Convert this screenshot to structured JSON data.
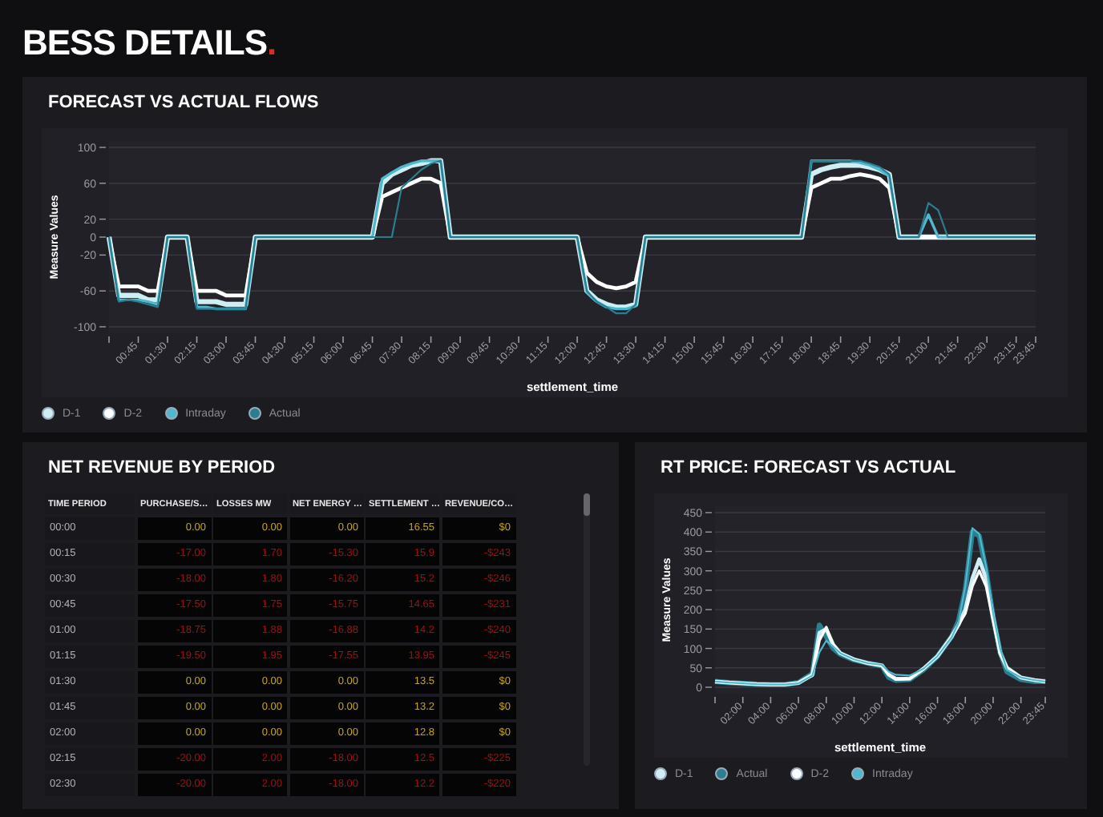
{
  "header": {
    "title": "BESS DETAILS",
    "accent": "."
  },
  "flows": {
    "title": "FORECAST VS ACTUAL FLOWS",
    "chart_data": {
      "type": "line",
      "xlabel": "settlement_time",
      "ylabel": "Measure Values",
      "x": [
        0,
        0.25,
        0.5,
        0.75,
        1,
        1.25,
        1.5,
        1.75,
        2,
        2.25,
        2.5,
        2.75,
        3,
        3.25,
        3.5,
        3.75,
        4,
        4.25,
        4.5,
        4.75,
        5,
        5.25,
        5.5,
        5.75,
        6,
        6.25,
        6.5,
        6.75,
        7,
        7.25,
        7.5,
        7.75,
        8,
        8.25,
        8.5,
        8.75,
        9,
        9.25,
        9.5,
        9.75,
        10,
        10.25,
        10.5,
        10.75,
        11,
        11.25,
        11.5,
        11.75,
        12,
        12.25,
        12.5,
        12.75,
        13,
        13.25,
        13.5,
        13.75,
        14,
        14.25,
        14.5,
        14.75,
        15,
        15.25,
        15.5,
        15.75,
        16,
        16.25,
        16.5,
        16.75,
        17,
        17.25,
        17.5,
        17.75,
        18,
        18.25,
        18.5,
        18.75,
        19,
        19.25,
        19.5,
        19.75,
        20,
        20.25,
        20.5,
        20.75,
        21,
        21.25,
        21.5,
        21.75,
        22,
        22.25,
        22.5,
        22.75,
        23,
        23.25,
        23.5,
        23.75
      ],
      "xlim": [
        0,
        23.75
      ],
      "ylim": [
        -100,
        100
      ],
      "grid": true,
      "yticks": [
        -100,
        -60,
        -20,
        0,
        20,
        60,
        100
      ],
      "xticks": [
        {
          "value": 0.75,
          "label": "00:45"
        },
        {
          "value": 1.5,
          "label": "01:30"
        },
        {
          "value": 2.25,
          "label": "02:15"
        },
        {
          "value": 3,
          "label": "03:00"
        },
        {
          "value": 3.75,
          "label": "03:45"
        },
        {
          "value": 4.5,
          "label": "04:30"
        },
        {
          "value": 5.25,
          "label": "05:15"
        },
        {
          "value": 6,
          "label": "06:00"
        },
        {
          "value": 6.75,
          "label": "06:45"
        },
        {
          "value": 7.5,
          "label": "07:30"
        },
        {
          "value": 8.25,
          "label": "08:15"
        },
        {
          "value": 9,
          "label": "09:00"
        },
        {
          "value": 9.75,
          "label": "09:45"
        },
        {
          "value": 10.5,
          "label": "10:30"
        },
        {
          "value": 11.25,
          "label": "11:15"
        },
        {
          "value": 12,
          "label": "12:00"
        },
        {
          "value": 12.75,
          "label": "12:45"
        },
        {
          "value": 13.5,
          "label": "13:30"
        },
        {
          "value": 14.25,
          "label": "14:15"
        },
        {
          "value": 15,
          "label": "15:00"
        },
        {
          "value": 15.75,
          "label": "15:45"
        },
        {
          "value": 16.5,
          "label": "16:30"
        },
        {
          "value": 17.25,
          "label": "17:15"
        },
        {
          "value": 18,
          "label": "18:00"
        },
        {
          "value": 18.75,
          "label": "18:45"
        },
        {
          "value": 19.5,
          "label": "19:30"
        },
        {
          "value": 20.25,
          "label": "20:15"
        },
        {
          "value": 21,
          "label": "21:00"
        },
        {
          "value": 21.75,
          "label": "21:45"
        },
        {
          "value": 22.5,
          "label": "22:30"
        },
        {
          "value": 23.25,
          "label": "23:15"
        },
        {
          "value": 23.75,
          "label": "23:45"
        }
      ],
      "series": [
        {
          "name": "D-1",
          "color": "#cfeef4",
          "values": [
            0,
            -65,
            -65,
            -65,
            -70,
            -70,
            0,
            0,
            0,
            -72,
            -72,
            -72,
            -75,
            -75,
            -75,
            0,
            0,
            0,
            0,
            0,
            0,
            0,
            0,
            0,
            0,
            0,
            0,
            0,
            60,
            70,
            75,
            80,
            82,
            85,
            85,
            0,
            0,
            0,
            0,
            0,
            0,
            0,
            0,
            0,
            0,
            0,
            0,
            0,
            0,
            -60,
            -70,
            -75,
            -78,
            -78,
            -75,
            0,
            0,
            0,
            0,
            0,
            0,
            0,
            0,
            0,
            0,
            0,
            0,
            0,
            0,
            0,
            0,
            0,
            70,
            75,
            78,
            80,
            80,
            80,
            78,
            75,
            70,
            0,
            0,
            0,
            0,
            0,
            0,
            0,
            0,
            0,
            0,
            0,
            0,
            0,
            0,
            0
          ]
        },
        {
          "name": "D-2",
          "color": "#ffffff",
          "values": [
            0,
            -55,
            -55,
            -55,
            -60,
            -60,
            0,
            0,
            0,
            -60,
            -60,
            -60,
            -65,
            -65,
            -65,
            0,
            0,
            0,
            0,
            0,
            0,
            0,
            0,
            0,
            0,
            0,
            0,
            0,
            45,
            50,
            55,
            60,
            65,
            65,
            60,
            0,
            0,
            0,
            0,
            0,
            0,
            0,
            0,
            0,
            0,
            0,
            0,
            0,
            0,
            -40,
            -50,
            -55,
            -57,
            -55,
            -50,
            0,
            0,
            0,
            0,
            0,
            0,
            0,
            0,
            0,
            0,
            0,
            0,
            0,
            0,
            0,
            0,
            0,
            55,
            60,
            65,
            65,
            68,
            70,
            68,
            65,
            55,
            0,
            0,
            0,
            0,
            0,
            0,
            0,
            0,
            0,
            0,
            0,
            0,
            0,
            0,
            0
          ]
        },
        {
          "name": "Intraday",
          "color": "#4fb8cc",
          "values": [
            0,
            -70,
            -70,
            -70,
            -72,
            -75,
            0,
            0,
            0,
            -78,
            -78,
            -80,
            -80,
            -80,
            -80,
            0,
            0,
            0,
            0,
            0,
            0,
            0,
            0,
            0,
            0,
            0,
            0,
            0,
            65,
            72,
            78,
            82,
            85,
            85,
            85,
            0,
            0,
            0,
            0,
            0,
            0,
            0,
            0,
            0,
            0,
            0,
            0,
            0,
            0,
            -62,
            -72,
            -78,
            -80,
            -80,
            -77,
            0,
            0,
            0,
            0,
            0,
            0,
            0,
            0,
            0,
            0,
            0,
            0,
            0,
            0,
            0,
            0,
            0,
            85,
            85,
            85,
            85,
            85,
            83,
            80,
            75,
            68,
            0,
            0,
            0,
            25,
            0,
            0,
            0,
            0,
            0,
            0,
            0,
            0,
            0,
            0,
            0
          ]
        },
        {
          "name": "Actual",
          "color": "#2b7d8f",
          "values": [
            0,
            -72,
            -70,
            -72,
            -75,
            -78,
            0,
            0,
            0,
            -80,
            -80,
            -80,
            -80,
            -80,
            -80,
            0,
            0,
            0,
            0,
            0,
            0,
            0,
            0,
            0,
            0,
            0,
            0,
            0,
            0,
            0,
            55,
            65,
            75,
            82,
            85,
            0,
            0,
            0,
            0,
            0,
            0,
            0,
            0,
            0,
            0,
            0,
            0,
            0,
            0,
            -60,
            -72,
            -78,
            -85,
            -85,
            -75,
            0,
            0,
            0,
            0,
            0,
            0,
            0,
            0,
            0,
            0,
            0,
            0,
            0,
            0,
            0,
            0,
            0,
            85,
            85,
            85,
            85,
            85,
            85,
            82,
            78,
            70,
            0,
            0,
            0,
            38,
            30,
            0,
            0,
            0,
            0,
            0,
            0,
            0,
            0,
            0,
            0
          ]
        }
      ]
    }
  },
  "revenue": {
    "title": "NET REVENUE BY PERIOD",
    "columns": [
      "TIME PERIOD",
      "PURCHASE/S…",
      "LOSSES MW",
      "NET ENERGY …",
      "SETTLEMENT …",
      "REVENUE/CO…"
    ],
    "rows": [
      {
        "negative": false,
        "cells": [
          "00:00",
          "0.00",
          "0.00",
          "0.00",
          "16.55",
          "$0"
        ]
      },
      {
        "negative": true,
        "cells": [
          "00:15",
          "-17.00",
          "1.70",
          "-15.30",
          "15.9",
          "-$243"
        ]
      },
      {
        "negative": true,
        "cells": [
          "00:30",
          "-18.00",
          "1.80",
          "-16.20",
          "15.2",
          "-$246"
        ]
      },
      {
        "negative": true,
        "cells": [
          "00:45",
          "-17.50",
          "1.75",
          "-15.75",
          "14.65",
          "-$231"
        ]
      },
      {
        "negative": true,
        "cells": [
          "01:00",
          "-18.75",
          "1.88",
          "-16.88",
          "14.2",
          "-$240"
        ]
      },
      {
        "negative": true,
        "cells": [
          "01:15",
          "-19.50",
          "1.95",
          "-17.55",
          "13.95",
          "-$245"
        ]
      },
      {
        "negative": false,
        "cells": [
          "01:30",
          "0.00",
          "0.00",
          "0.00",
          "13.5",
          "$0"
        ]
      },
      {
        "negative": false,
        "cells": [
          "01:45",
          "0.00",
          "0.00",
          "0.00",
          "13.2",
          "$0"
        ]
      },
      {
        "negative": false,
        "cells": [
          "02:00",
          "0.00",
          "0.00",
          "0.00",
          "12.8",
          "$0"
        ]
      },
      {
        "negative": true,
        "cells": [
          "02:15",
          "-20.00",
          "2.00",
          "-18.00",
          "12.5",
          "-$225"
        ]
      },
      {
        "negative": true,
        "cells": [
          "02:30",
          "-20.00",
          "2.00",
          "-18.00",
          "12.2",
          "-$220"
        ]
      }
    ]
  },
  "price": {
    "title": "RT PRICE: FORECAST VS ACTUAL",
    "chart_data": {
      "type": "line",
      "xlabel": "settlement_time",
      "ylabel": "Measure Values",
      "x": [
        0,
        1,
        2,
        3,
        4,
        5,
        6,
        7,
        7.5,
        8,
        8.5,
        9,
        10,
        11,
        12,
        12.5,
        13,
        14,
        15,
        16,
        17,
        17.5,
        18,
        18.5,
        19,
        19.5,
        20,
        20.5,
        21,
        22,
        23,
        23.75
      ],
      "xlim": [
        0,
        23.75
      ],
      "ylim": [
        0,
        450
      ],
      "grid": true,
      "yticks": [
        0,
        50,
        100,
        150,
        200,
        250,
        300,
        350,
        400,
        450
      ],
      "xticks": [
        {
          "value": 2,
          "label": "02:00"
        },
        {
          "value": 4,
          "label": "04:00"
        },
        {
          "value": 6,
          "label": "06:00"
        },
        {
          "value": 8,
          "label": "08:00"
        },
        {
          "value": 10,
          "label": "10:00"
        },
        {
          "value": 12,
          "label": "12:00"
        },
        {
          "value": 14,
          "label": "14:00"
        },
        {
          "value": 16,
          "label": "16:00"
        },
        {
          "value": 18,
          "label": "18:00"
        },
        {
          "value": 20,
          "label": "20:00"
        },
        {
          "value": 22,
          "label": "22:00"
        },
        {
          "value": 23.75,
          "label": "23:45"
        }
      ],
      "series": [
        {
          "name": "D-1",
          "color": "#cfeef4",
          "values": [
            15,
            12,
            10,
            8,
            7,
            7,
            11,
            32,
            140,
            150,
            110,
            88,
            72,
            62,
            56,
            32,
            22,
            22,
            48,
            80,
            130,
            160,
            200,
            280,
            330,
            280,
            180,
            90,
            50,
            25,
            18,
            15
          ]
        },
        {
          "name": "Actual",
          "color": "#2b7d8f",
          "values": [
            15,
            12,
            10,
            8,
            7,
            7,
            12,
            35,
            160,
            130,
            100,
            85,
            70,
            62,
            55,
            25,
            18,
            20,
            45,
            80,
            130,
            170,
            250,
            400,
            390,
            300,
            180,
            90,
            40,
            20,
            15,
            15
          ]
        },
        {
          "name": "D-2",
          "color": "#ffffff",
          "values": [
            15,
            12,
            10,
            8,
            7,
            7,
            11,
            30,
            120,
            155,
            110,
            88,
            72,
            62,
            56,
            32,
            20,
            22,
            48,
            80,
            130,
            160,
            190,
            260,
            300,
            260,
            170,
            85,
            50,
            25,
            18,
            15
          ]
        },
        {
          "name": "Intraday",
          "color": "#4fb8cc",
          "values": [
            15,
            12,
            10,
            8,
            7,
            7,
            10,
            30,
            90,
            120,
            105,
            88,
            72,
            62,
            58,
            40,
            32,
            30,
            48,
            80,
            128,
            165,
            260,
            410,
            395,
            310,
            190,
            100,
            45,
            25,
            18,
            15
          ]
        }
      ]
    }
  }
}
